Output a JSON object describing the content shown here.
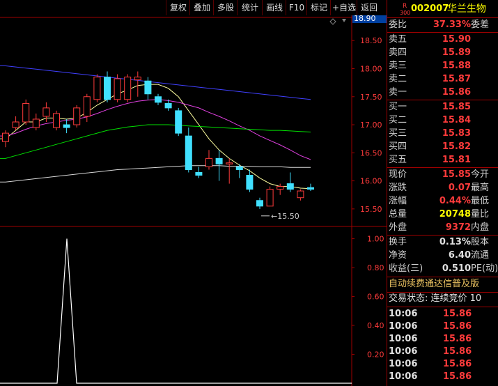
{
  "toolbar": {
    "buttons": [
      "复权",
      "叠加",
      "多股",
      "统计",
      "画线",
      "F10",
      "标记",
      "+自选",
      "返回"
    ]
  },
  "stock": {
    "badge_top": "R",
    "badge_bottom": "300",
    "code": "002007",
    "name": "华兰生物"
  },
  "order_book": {
    "ratio_label": "委比",
    "ratio_value": "37.33%",
    "diff_label": "委差",
    "asks": [
      {
        "label": "卖五",
        "price": "15.90"
      },
      {
        "label": "卖四",
        "price": "15.89"
      },
      {
        "label": "卖三",
        "price": "15.88"
      },
      {
        "label": "卖二",
        "price": "15.87"
      },
      {
        "label": "卖一",
        "price": "15.86"
      }
    ],
    "bids": [
      {
        "label": "买一",
        "price": "15.85"
      },
      {
        "label": "买二",
        "price": "15.84"
      },
      {
        "label": "买三",
        "price": "15.83"
      },
      {
        "label": "买四",
        "price": "15.82"
      },
      {
        "label": "买五",
        "price": "15.81"
      }
    ]
  },
  "quote": [
    {
      "label": "现价",
      "value": "15.85",
      "label2": "今开",
      "color": "red"
    },
    {
      "label": "涨跌",
      "value": "0.07",
      "label2": "最高",
      "color": "red"
    },
    {
      "label": "涨幅",
      "value": "0.44%",
      "label2": "最低",
      "color": "red"
    },
    {
      "label": "总量",
      "value": "20748",
      "label2": "量比",
      "color": "yel"
    },
    {
      "label": "外盘",
      "value": "9372",
      "label2": "内盘",
      "color": "red"
    }
  ],
  "finance": [
    {
      "label": "换手",
      "value": "0.13%",
      "label2": "股本"
    },
    {
      "label": "净资",
      "value": "6.40",
      "label2": "流通"
    },
    {
      "label": "收益(三)",
      "value": "0.510",
      "label2": "PE(动)"
    }
  ],
  "notice": "自动续费通达信普及版",
  "trade_status": "交易状态: 连续竞价 10",
  "ticks": [
    {
      "time": "10:06",
      "price": "15.86"
    },
    {
      "time": "10:06",
      "price": "15.86"
    },
    {
      "time": "10:06",
      "price": "15.86"
    },
    {
      "time": "10:06",
      "price": "15.86"
    },
    {
      "time": "10:06",
      "price": "15.86"
    },
    {
      "time": "10:06",
      "price": "15.86"
    }
  ],
  "chart_data": {
    "type": "candlestick",
    "price_axis": {
      "ticks": [
        "18.50",
        "18.00",
        "17.50",
        "17.00",
        "16.50",
        "16.00",
        "15.50"
      ],
      "ylim": [
        15.2,
        18.95
      ],
      "cursor_value": "18.90"
    },
    "low_annotation": "15.50",
    "candles": [
      {
        "o": 16.7,
        "h": 16.9,
        "l": 16.6,
        "c": 16.85
      },
      {
        "o": 16.95,
        "h": 17.15,
        "l": 16.9,
        "c": 17.05
      },
      {
        "o": 17.05,
        "h": 17.45,
        "l": 17.0,
        "c": 17.38
      },
      {
        "o": 16.95,
        "h": 17.2,
        "l": 16.9,
        "c": 17.1
      },
      {
        "o": 17.15,
        "h": 17.4,
        "l": 17.05,
        "c": 17.3
      },
      {
        "o": 16.95,
        "h": 17.25,
        "l": 16.9,
        "c": 17.2
      },
      {
        "o": 17.0,
        "h": 17.1,
        "l": 16.85,
        "c": 16.95
      },
      {
        "o": 17.0,
        "h": 17.35,
        "l": 16.95,
        "c": 17.3
      },
      {
        "o": 17.15,
        "h": 17.55,
        "l": 17.05,
        "c": 17.5
      },
      {
        "o": 17.45,
        "h": 17.9,
        "l": 17.4,
        "c": 17.85
      },
      {
        "o": 17.85,
        "h": 17.95,
        "l": 17.4,
        "c": 17.45
      },
      {
        "o": 17.45,
        "h": 17.9,
        "l": 17.4,
        "c": 17.82
      },
      {
        "o": 17.45,
        "h": 17.9,
        "l": 17.4,
        "c": 17.85
      },
      {
        "o": 17.8,
        "h": 17.95,
        "l": 17.5,
        "c": 17.85
      },
      {
        "o": 17.78,
        "h": 17.85,
        "l": 17.45,
        "c": 17.55
      },
      {
        "o": 17.5,
        "h": 17.55,
        "l": 17.35,
        "c": 17.4
      },
      {
        "o": 17.38,
        "h": 17.45,
        "l": 17.25,
        "c": 17.3
      },
      {
        "o": 17.25,
        "h": 17.3,
        "l": 16.8,
        "c": 16.85
      },
      {
        "o": 16.8,
        "h": 16.95,
        "l": 16.15,
        "c": 16.2
      },
      {
        "o": 16.15,
        "h": 16.25,
        "l": 16.05,
        "c": 16.1
      },
      {
        "o": 16.25,
        "h": 16.55,
        "l": 16.2,
        "c": 16.4
      },
      {
        "o": 16.4,
        "h": 16.55,
        "l": 16.0,
        "c": 16.3
      },
      {
        "o": 16.3,
        "h": 16.4,
        "l": 15.95,
        "c": 16.32
      },
      {
        "o": 16.25,
        "h": 16.3,
        "l": 16.05,
        "c": 16.2
      },
      {
        "o": 16.1,
        "h": 16.2,
        "l": 15.8,
        "c": 15.85
      },
      {
        "o": 15.65,
        "h": 15.7,
        "l": 15.5,
        "c": 15.55
      },
      {
        "o": 15.55,
        "h": 15.9,
        "l": 15.55,
        "c": 15.85
      },
      {
        "o": 15.85,
        "h": 15.95,
        "l": 15.75,
        "c": 15.9
      },
      {
        "o": 15.95,
        "h": 16.15,
        "l": 15.8,
        "c": 15.85
      },
      {
        "o": 15.7,
        "h": 15.85,
        "l": 15.65,
        "c": 15.82
      },
      {
        "o": 15.88,
        "h": 15.95,
        "l": 15.82,
        "c": 15.85
      }
    ],
    "ma_lines": [
      {
        "color": "#ffffa0",
        "values": [
          16.75,
          16.9,
          17.05,
          17.05,
          17.12,
          17.12,
          17.1,
          17.12,
          17.22,
          17.35,
          17.45,
          17.55,
          17.62,
          17.7,
          17.72,
          17.72,
          17.65,
          17.5,
          17.25,
          17.0,
          16.75,
          16.55,
          16.4,
          16.28,
          16.18,
          16.05,
          15.95,
          15.9,
          15.9,
          15.87,
          15.86
        ]
      },
      {
        "color": "#e040e0",
        "values": [
          16.8,
          16.85,
          16.92,
          16.98,
          17.02,
          17.05,
          17.08,
          17.1,
          17.14,
          17.2,
          17.27,
          17.33,
          17.38,
          17.42,
          17.44,
          17.45,
          17.43,
          17.4,
          17.35,
          17.3,
          17.22,
          17.15,
          17.07,
          16.98,
          16.9,
          16.8,
          16.72,
          16.64,
          16.55,
          16.45,
          16.38
        ]
      },
      {
        "color": "#00e000",
        "values": [
          16.4,
          16.45,
          16.5,
          16.55,
          16.6,
          16.65,
          16.7,
          16.75,
          16.8,
          16.85,
          16.9,
          16.93,
          16.96,
          16.98,
          17.0,
          17.0,
          17.0,
          16.99,
          16.98,
          16.97,
          16.96,
          16.95,
          16.94,
          16.93,
          16.92,
          16.91,
          16.9,
          16.9,
          16.89,
          16.88,
          16.87
        ]
      },
      {
        "color": "#d8d8d8",
        "values": [
          15.98,
          16.0,
          16.02,
          16.04,
          16.06,
          16.08,
          16.1,
          16.12,
          16.14,
          16.16,
          16.18,
          16.2,
          16.21,
          16.22,
          16.23,
          16.24,
          16.25,
          16.26,
          16.27,
          16.27,
          16.27,
          16.27,
          16.26,
          16.26,
          16.26,
          16.25,
          16.25,
          16.25,
          16.24,
          16.24,
          16.24
        ]
      },
      {
        "color": "#4040ff",
        "values": [
          18.05,
          18.03,
          18.01,
          17.99,
          17.97,
          17.95,
          17.93,
          17.91,
          17.89,
          17.87,
          17.85,
          17.83,
          17.81,
          17.79,
          17.77,
          17.75,
          17.73,
          17.71,
          17.69,
          17.67,
          17.65,
          17.63,
          17.61,
          17.59,
          17.57,
          17.55,
          17.53,
          17.51,
          17.49,
          17.47,
          17.45
        ]
      }
    ],
    "indicator": {
      "ticks": [
        "1.00",
        "0.80",
        "0.60",
        "0.40",
        "0.20"
      ],
      "ylim": [
        0,
        1.08
      ],
      "values": [
        0,
        0,
        0,
        0,
        0,
        0,
        0,
        0,
        0,
        0,
        0,
        0,
        0,
        0,
        0,
        0,
        0,
        0,
        0,
        0,
        0,
        0,
        0,
        0,
        0,
        0,
        0,
        0,
        0,
        0,
        0
      ],
      "spike": {
        "x": 96,
        "value": 1.0
      }
    }
  },
  "colors": {
    "up": "#ff3b3b",
    "down": "#40e0ff",
    "border": "#a00000"
  }
}
